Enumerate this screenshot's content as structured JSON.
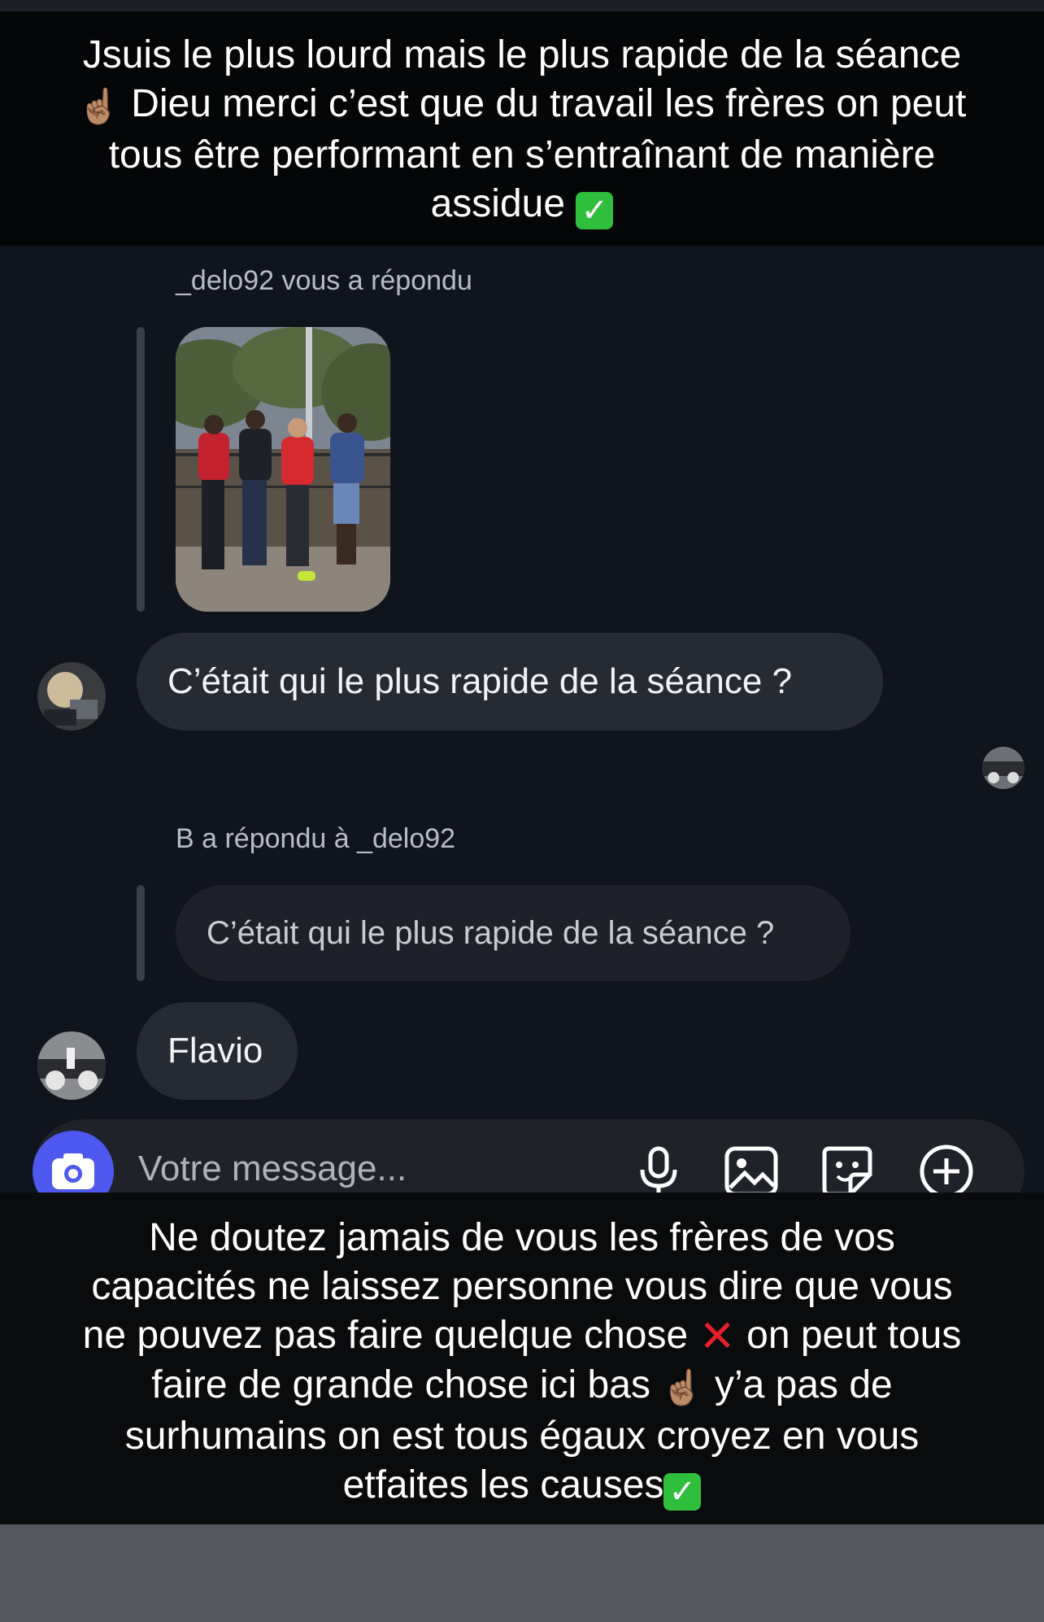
{
  "caption_top": {
    "lines": [
      "Jsuis le plus lourd mais le plus rapide de la séance",
      "Dieu merci c’est que du travail les frères on peut",
      "tous être performant en s’entraînant de manière",
      "assidue"
    ]
  },
  "messages": {
    "reply1_header": "_delo92 vous a répondu",
    "bubble1_text": "C’était qui le plus rapide de la séance ?",
    "reply2_header": "B a répondu à _delo92",
    "quoted_text": "C’était qui le plus rapide de la séance ?",
    "bubble2_text": "Flavio"
  },
  "composer": {
    "placeholder": "Votre message...",
    "icons": [
      "camera-icon",
      "microphone-icon",
      "image-icon",
      "sticker-icon",
      "plus-circle-icon"
    ],
    "accent": "#4d58ef"
  },
  "caption_bottom": {
    "lines": [
      "Ne doutez jamais de vous les frères de vos",
      "capacités ne laissez personne vous dire que vous",
      "ne pouvez pas faire quelque chose",
      "on peut tous",
      "faire de grande chose ici bas",
      "y’a pas de",
      "surhumains on est tous égaux croyez en vous",
      "etfaites les causes"
    ]
  }
}
